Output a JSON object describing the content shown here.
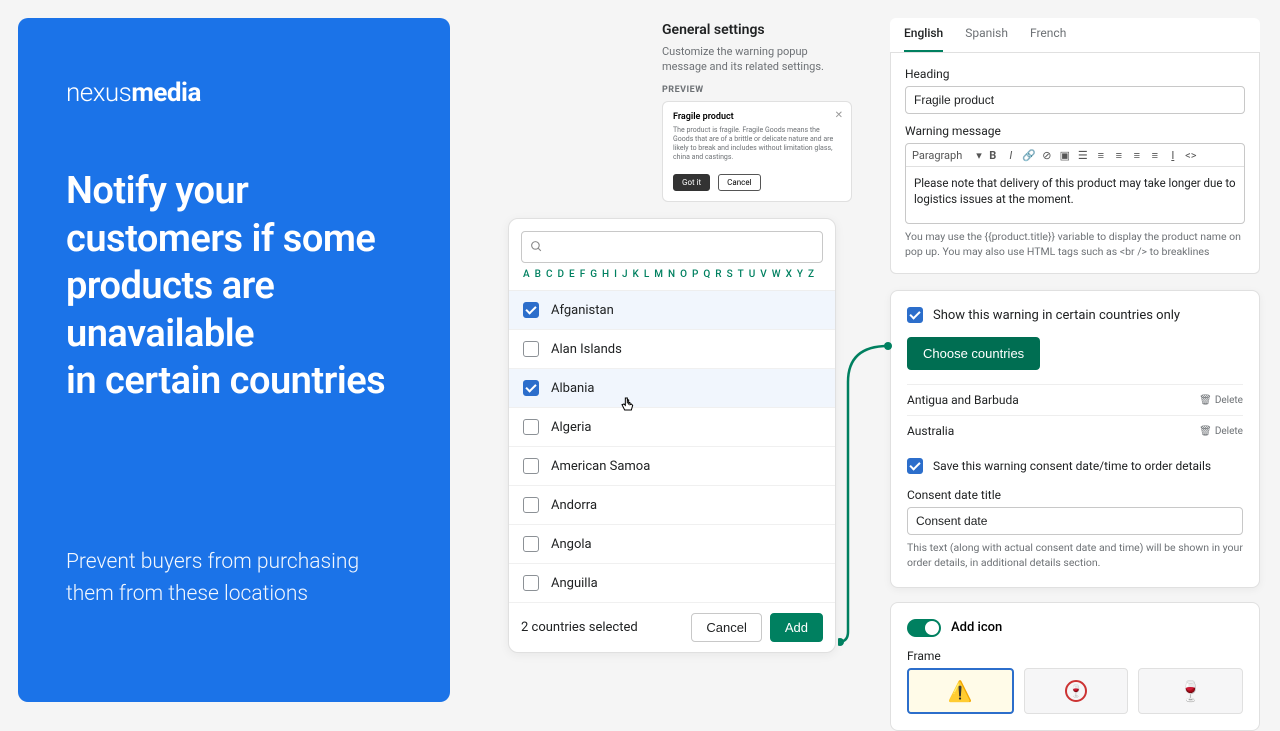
{
  "hero": {
    "logo_light": "nexus",
    "logo_bold": "media",
    "headline": "Notify your customers if some products are unavailable\nin certain countries",
    "sub": "Prevent buyers from purchasing them from these locations"
  },
  "picker": {
    "alpha": [
      "A",
      "B",
      "C",
      "D",
      "E",
      "F",
      "G",
      "H",
      "I",
      "J",
      "K",
      "L",
      "M",
      "N",
      "O",
      "P",
      "Q",
      "R",
      "S",
      "T",
      "U",
      "V",
      "W",
      "X",
      "Y",
      "Z"
    ],
    "countries": [
      {
        "name": "Afganistan",
        "checked": true
      },
      {
        "name": "Alan Islands",
        "checked": false
      },
      {
        "name": "Albania",
        "checked": true
      },
      {
        "name": "Algeria",
        "checked": false
      },
      {
        "name": "American Samoa",
        "checked": false
      },
      {
        "name": "Andorra",
        "checked": false
      },
      {
        "name": "Angola",
        "checked": false
      },
      {
        "name": "Anguilla",
        "checked": false
      }
    ],
    "selected_label": "2 countries selected",
    "cancel": "Cancel",
    "add": "Add"
  },
  "general": {
    "title": "General settings",
    "desc": "Customize the warning popup message and its related settings.",
    "preview_label": "PREVIEW",
    "preview_title": "Fragile product",
    "preview_text": "The product is fragile. Fragile Goods means the Goods that are of a brittle or delicate nature and are likely to break and includes without limitation glass, china and castings.",
    "got_it": "Got it",
    "cancel": "Cancel"
  },
  "settings": {
    "tabs": [
      "English",
      "Spanish",
      "French"
    ],
    "heading_label": "Heading",
    "heading_value": "Fragile product",
    "warning_label": "Warning message",
    "paragraph": "Paragraph",
    "warning_body": "Please note that delivery of this product may take longer due to logistics issues at the moment.",
    "hint": "You may use the {{product.title}} variable to display the product name on pop up. You may also use HTML tags such as <br /> to breaklines",
    "show_countries_label": "Show this warning in certain countries only",
    "choose_btn": "Choose countries",
    "selected_countries": [
      "Antigua and Barbuda",
      "Australia"
    ],
    "delete": "Delete",
    "save_consent_label": "Save this warning consent date/time to order details",
    "consent_title_label": "Consent date title",
    "consent_title_value": "Consent date",
    "consent_hint": "This text (along with actual consent date and time) will be shown in your order details, in additional details section.",
    "add_icon_label": "Add icon",
    "frame_label": "Frame"
  }
}
